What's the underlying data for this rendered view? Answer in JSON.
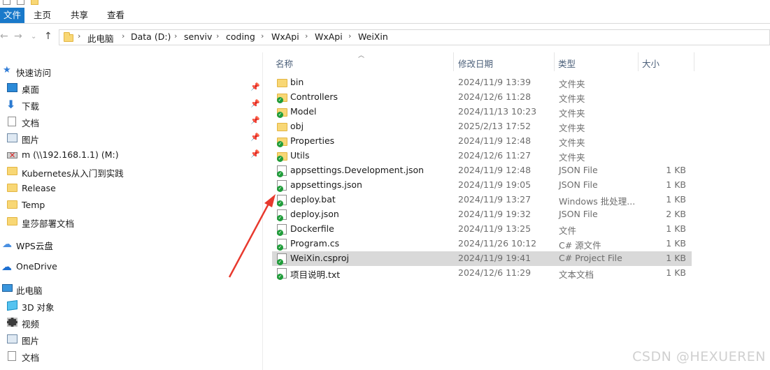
{
  "ribbon": {
    "tabs": [
      "文件",
      "主页",
      "共享",
      "查看"
    ]
  },
  "address": {
    "crumbs": [
      "此电脑",
      "Data (D:)",
      "senviv",
      "coding",
      "WxApi",
      "WxApi",
      "WeiXin"
    ]
  },
  "nav_pane": {
    "quick_access": "快速访问",
    "pinned": [
      "桌面",
      "下载",
      "文档",
      "图片",
      "m (\\\\192.168.1.1) (M:)"
    ],
    "folders": [
      "Kubernetes从入门到实践",
      "Release",
      "Temp",
      "皇莎部署文档"
    ],
    "wps": "WPS云盘",
    "onedrive": "OneDrive",
    "this_pc": "此电脑",
    "pc_items": [
      "3D 对象",
      "视频",
      "图片",
      "文档"
    ]
  },
  "columns": {
    "name": "名称",
    "date": "修改日期",
    "type": "类型",
    "size": "大小"
  },
  "files": [
    {
      "name": "bin",
      "date": "2024/11/9 13:39",
      "type": "文件夹",
      "size": "",
      "kind": "folder",
      "synced": false
    },
    {
      "name": "Controllers",
      "date": "2024/12/6 11:28",
      "type": "文件夹",
      "size": "",
      "kind": "folder",
      "synced": true
    },
    {
      "name": "Model",
      "date": "2024/11/13 10:23",
      "type": "文件夹",
      "size": "",
      "kind": "folder",
      "synced": true
    },
    {
      "name": "obj",
      "date": "2025/2/13 17:52",
      "type": "文件夹",
      "size": "",
      "kind": "folder",
      "synced": false
    },
    {
      "name": "Properties",
      "date": "2024/11/9 12:48",
      "type": "文件夹",
      "size": "",
      "kind": "folder",
      "synced": true
    },
    {
      "name": "Utils",
      "date": "2024/12/6 11:27",
      "type": "文件夹",
      "size": "",
      "kind": "folder",
      "synced": true
    },
    {
      "name": "appsettings.Development.json",
      "date": "2024/11/9 12:48",
      "type": "JSON File",
      "size": "1 KB",
      "kind": "file",
      "synced": true
    },
    {
      "name": "appsettings.json",
      "date": "2024/11/9 19:05",
      "type": "JSON File",
      "size": "1 KB",
      "kind": "file",
      "synced": true
    },
    {
      "name": "deploy.bat",
      "date": "2024/11/9 13:27",
      "type": "Windows 批处理...",
      "size": "1 KB",
      "kind": "file",
      "synced": true
    },
    {
      "name": "deploy.json",
      "date": "2024/11/9 19:32",
      "type": "JSON File",
      "size": "2 KB",
      "kind": "file",
      "synced": true
    },
    {
      "name": "Dockerfile",
      "date": "2024/11/9 13:25",
      "type": "文件",
      "size": "1 KB",
      "kind": "file",
      "synced": true
    },
    {
      "name": "Program.cs",
      "date": "2024/11/26 10:12",
      "type": "C# 源文件",
      "size": "1 KB",
      "kind": "file",
      "synced": true
    },
    {
      "name": "WeiXin.csproj",
      "date": "2024/11/9 19:41",
      "type": "C# Project File",
      "size": "1 KB",
      "kind": "file",
      "synced": true,
      "selected": true
    },
    {
      "name": "项目说明.txt",
      "date": "2024/12/6 11:29",
      "type": "文本文档",
      "size": "1 KB",
      "kind": "file",
      "synced": true
    }
  ],
  "watermark": "CSDN @HEXUEREN",
  "colors": {
    "file_tab": "#1979ca",
    "selection": "#d9d9d9",
    "annotation_arrow": "#e8392e",
    "sync_check": "#1f9d3a"
  }
}
